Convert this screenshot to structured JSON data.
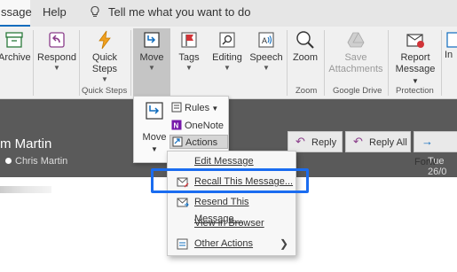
{
  "tabs": {
    "active": "ssage",
    "help": "Help",
    "tell_me": "Tell me what you want to do"
  },
  "ribbon": {
    "buttons": {
      "archive": "Archive",
      "respond": "Respond",
      "quick_steps_line1": "Quick",
      "quick_steps_line2": "Steps",
      "move": "Move",
      "tags": "Tags",
      "editing": "Editing",
      "speech": "Speech",
      "zoom": "Zoom",
      "save_attachments_line1": "Save",
      "save_attachments_line2": "Attachments",
      "report_message_line1": "Report",
      "report_message_line2": "Message",
      "insights_partial": "In"
    },
    "groups": {
      "quick_steps": "Quick Steps",
      "zoom": "Zoom",
      "google_drive": "Google Drive",
      "protection": "Protection"
    }
  },
  "move_menu": {
    "move": "Move",
    "rules": "Rules",
    "onenote": "OneNote",
    "actions": "Actions"
  },
  "actions_submenu": {
    "items": [
      {
        "label": "Edit Message"
      },
      {
        "label": "Recall This Message..."
      },
      {
        "label": "Resend This Message..."
      },
      {
        "label": "View in Browser"
      },
      {
        "label": "Other Actions"
      }
    ]
  },
  "message": {
    "sender": "m Martin",
    "to": "Chris Martin",
    "date": "Tue 26/0"
  },
  "message_actions": {
    "reply": "Reply",
    "reply_all": "Reply All",
    "forward": "Forw"
  },
  "colors": {
    "highlight": "#1a6cf0",
    "accent": "#0f6cbd",
    "reading_pane": "#5a5a5a"
  }
}
